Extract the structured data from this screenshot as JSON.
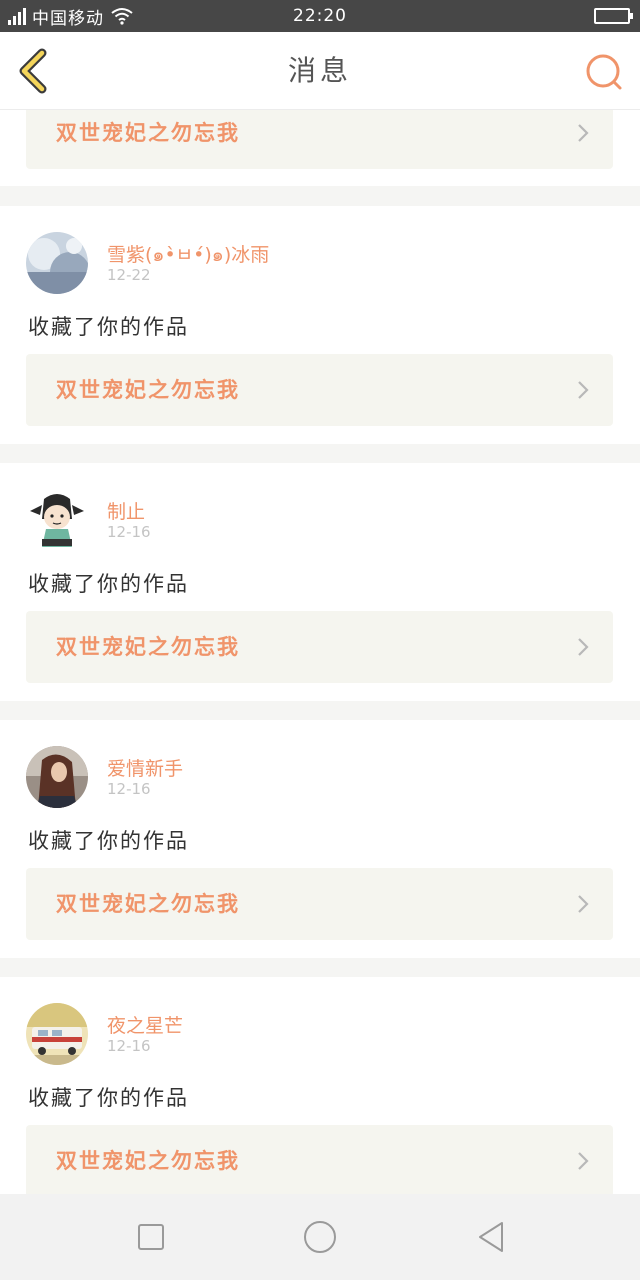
{
  "status_bar": {
    "carrier": "中国移动",
    "time": "22:20",
    "icons": [
      "signal-icon",
      "wifi-icon",
      "battery-icon"
    ]
  },
  "nav": {
    "title": "消息",
    "back_icon": "chevron-left-icon",
    "search_icon": "search-icon",
    "accent_color": "#f0946a"
  },
  "partial_item": {
    "work_title": "双世宠妃之勿忘我"
  },
  "notifications": [
    {
      "username": "雪紫(๑•̀ㅂ•́)๑)冰雨",
      "date": "12-22",
      "action": "收藏了你的作品",
      "work_title": "双世宠妃之勿忘我",
      "avatar": "avatar-photo"
    },
    {
      "username": "制止",
      "date": "12-16",
      "action": "收藏了你的作品",
      "work_title": "双世宠妃之勿忘我",
      "avatar": "avatar-cartoon"
    },
    {
      "username": "爱情新手",
      "date": "12-16",
      "action": "收藏了你的作品",
      "work_title": "双世宠妃之勿忘我",
      "avatar": "avatar-photo"
    },
    {
      "username": "夜之星芒",
      "date": "12-16",
      "action": "收藏了你的作品",
      "work_title": "双世宠妃之勿忘我",
      "avatar": "avatar-photo"
    }
  ],
  "system_nav": {
    "icons": [
      "square-icon",
      "circle-icon",
      "triangle-icon"
    ]
  }
}
